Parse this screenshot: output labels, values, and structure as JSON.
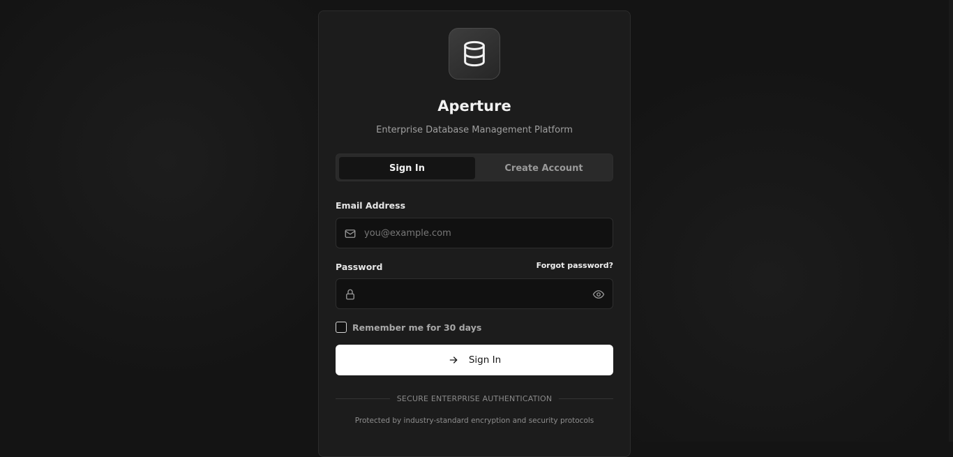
{
  "app": {
    "title": "Aperture",
    "subtitle": "Enterprise Database Management Platform"
  },
  "tabs": [
    {
      "label": "Sign In",
      "active": true
    },
    {
      "label": "Create Account",
      "active": false
    }
  ],
  "form": {
    "email_label": "Email Address",
    "email_placeholder": "you@example.com",
    "email_value": "",
    "password_label": "Password",
    "password_value": "",
    "forgot_label": "Forgot password?",
    "remember_label": "Remember me for 30 days",
    "remember_checked": false,
    "submit_label": "Sign In"
  },
  "divider_text": "SECURE ENTERPRISE AUTHENTICATION",
  "footer_text": "Protected by industry-standard encryption and security protocols",
  "icons": {
    "logo": "database-icon",
    "email": "mail-icon",
    "password": "lock-icon",
    "reveal": "eye-icon",
    "submit": "arrow-right-icon"
  },
  "colors": {
    "background": "#141414",
    "card": "#1c1c1c",
    "primary_button": "#ffffff",
    "input_bg": "#111111"
  }
}
